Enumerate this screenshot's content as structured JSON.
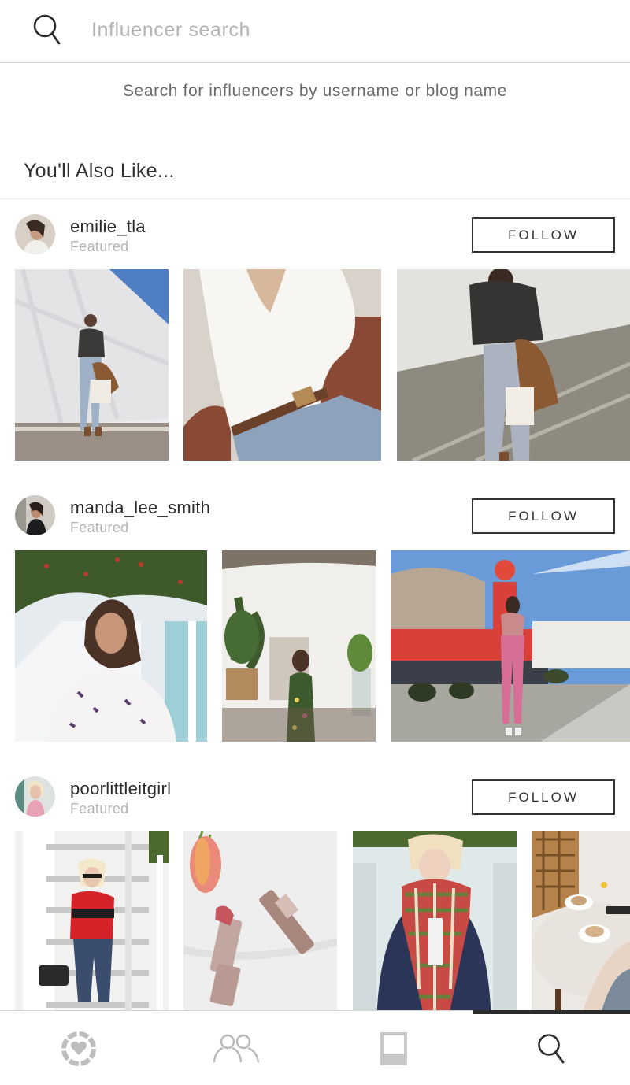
{
  "search": {
    "placeholder": "Influencer search",
    "value": ""
  },
  "hint_text": "Search for influencers by username or blog name",
  "section_title": "You'll Also Like...",
  "follow_label": "FOLLOW",
  "influencers": [
    {
      "username": "emilie_tla",
      "status": "Featured"
    },
    {
      "username": "manda_lee_smith",
      "status": "Featured"
    },
    {
      "username": "poorlittleitgirl",
      "status": "Featured"
    }
  ],
  "tabs": [
    {
      "icon": "heart-badge-icon"
    },
    {
      "icon": "people-icon"
    },
    {
      "icon": "phone-frame-icon"
    },
    {
      "icon": "search-icon",
      "active": true
    }
  ],
  "colors": {
    "text": "#2b2b2b",
    "muted": "#b5b5b5",
    "border": "#333333",
    "tab_icon": "#b9b9b9"
  }
}
